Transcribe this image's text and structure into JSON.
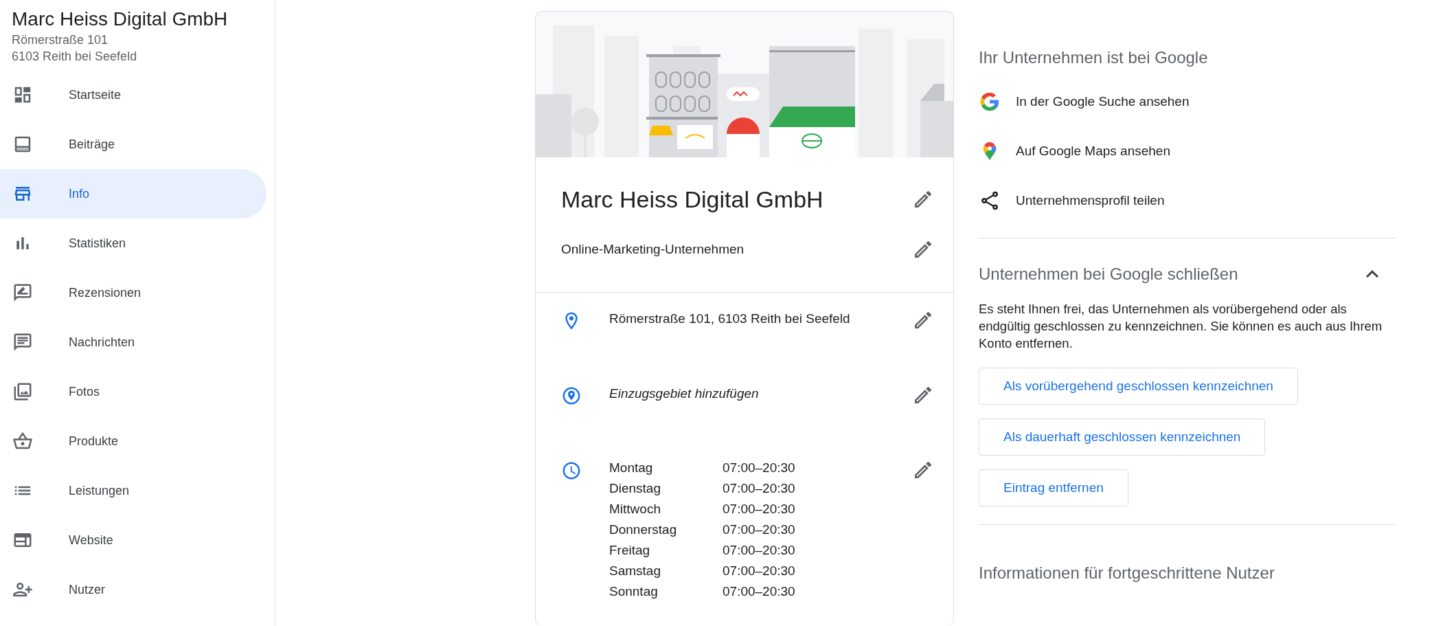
{
  "sidebar": {
    "business_name": "Marc Heiss Digital GmbH",
    "address_lines": [
      "Römerstraße 101",
      "6103 Reith bei Seefeld"
    ],
    "items": [
      {
        "label": "Startseite",
        "selected": false
      },
      {
        "label": "Beiträge",
        "selected": false
      },
      {
        "label": "Info",
        "selected": true
      },
      {
        "label": "Statistiken",
        "selected": false
      },
      {
        "label": "Rezensionen",
        "selected": false
      },
      {
        "label": "Nachrichten",
        "selected": false
      },
      {
        "label": "Fotos",
        "selected": false
      },
      {
        "label": "Produkte",
        "selected": false
      },
      {
        "label": "Leistungen",
        "selected": false
      },
      {
        "label": "Website",
        "selected": false
      },
      {
        "label": "Nutzer",
        "selected": false
      }
    ]
  },
  "card": {
    "title": "Marc Heiss Digital GmbH",
    "category": "Online-Marketing-Unternehmen",
    "rows": [
      {
        "kind": "address",
        "text": "Römerstraße 101, 6103 Reith bei Seefeld"
      },
      {
        "kind": "area",
        "text": "Einzugsgebiet hinzufügen"
      },
      {
        "kind": "hours",
        "hours": [
          {
            "day": "Montag",
            "time": "07:00–20:30"
          },
          {
            "day": "Dienstag",
            "time": "07:00–20:30"
          },
          {
            "day": "Mittwoch",
            "time": "07:00–20:30"
          },
          {
            "day": "Donnerstag",
            "time": "07:00–20:30"
          },
          {
            "day": "Freitag",
            "time": "07:00–20:30"
          },
          {
            "day": "Samstag",
            "time": "07:00–20:30"
          },
          {
            "day": "Sonntag",
            "time": "07:00–20:30"
          }
        ]
      }
    ]
  },
  "panel": {
    "heading": "Ihr Unternehmen ist bei Google",
    "links": [
      {
        "kind": "search",
        "label": "In der Google Suche ansehen"
      },
      {
        "kind": "maps",
        "label": "Auf Google Maps ansehen"
      },
      {
        "kind": "share",
        "label": "Unternehmensprofil teilen"
      }
    ],
    "close_section": {
      "heading": "Unternehmen bei Google schließen",
      "expanded": true,
      "text": "Es steht Ihnen frei, das Unternehmen als vorübergehend oder als endgültig geschlossen zu kennzeichnen. Sie können es auch aus Ihrem Konto entfernen.",
      "buttons": [
        "Als vorübergehend geschlossen kennzeichnen",
        "Als dauerhaft geschlossen kennzeichnen",
        "Eintrag entfernen"
      ]
    },
    "advanced_heading": "Informationen für fortgeschrittene Nutzer"
  }
}
